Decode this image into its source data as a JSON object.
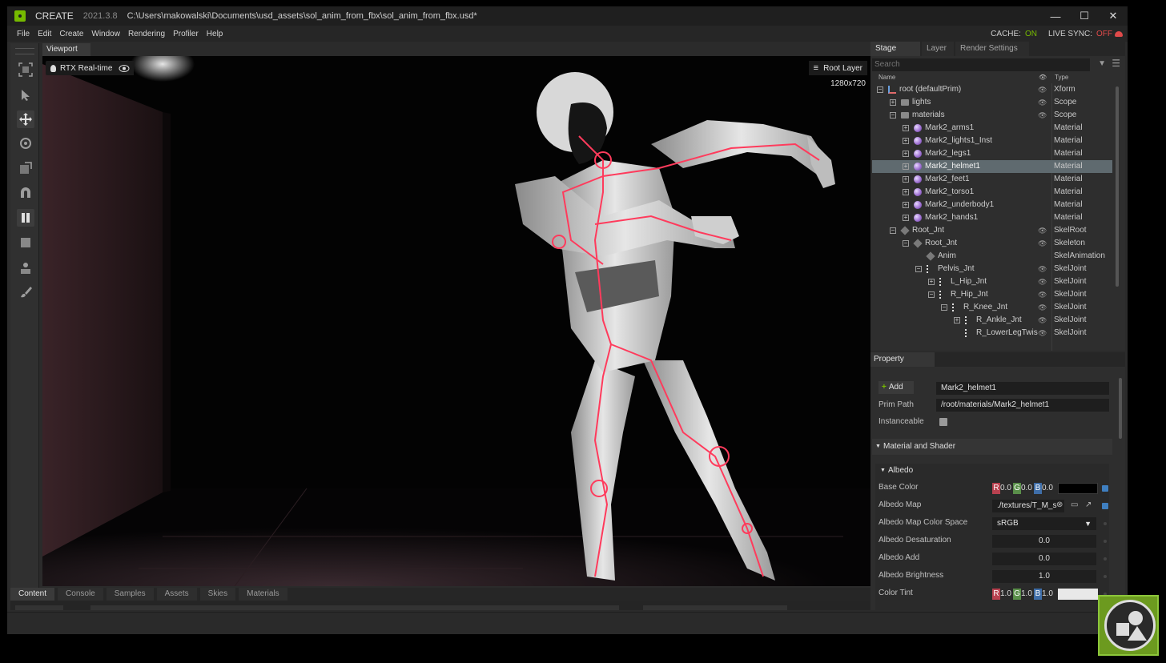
{
  "window": {
    "app_name": "CREATE",
    "version": "2021.3.8",
    "path": "C:\\Users\\makowalski\\Documents\\usd_assets\\sol_anim_from_fbx\\sol_anim_from_fbx.usd*",
    "controls": {
      "minimize": "—",
      "maximize": "☐",
      "close": "✕"
    }
  },
  "menu": {
    "items": [
      "File",
      "Edit",
      "Create",
      "Window",
      "Rendering",
      "Profiler",
      "Help"
    ],
    "cache_label": "CACHE:",
    "cache_value": "ON",
    "live_sync_label": "LIVE SYNC:",
    "live_sync_value": "OFF"
  },
  "viewport": {
    "tab_label": "Viewport",
    "render_mode": "RTX Real-time",
    "layer": "Root Layer",
    "resolution": "1280x720"
  },
  "toolbar": {
    "tools": [
      "frame-icon",
      "select-icon",
      "move-icon",
      "rotate-icon",
      "scale-icon",
      "snap-icon",
      "pause-icon",
      "stop-icon",
      "physics-icon",
      "paint-icon"
    ]
  },
  "bottom": {
    "tabs": [
      "Content",
      "Console",
      "Samples",
      "Assets",
      "Skies",
      "Materials"
    ],
    "active_tab": "Content"
  },
  "stage": {
    "tabs": [
      "Stage",
      "Layer",
      "Render Settings"
    ],
    "search_placeholder": "Search",
    "columns": {
      "name": "Name",
      "type": "Type"
    },
    "rows": [
      {
        "name": "root (defaultPrim)",
        "type": "Xform",
        "depth": 0,
        "expander": "minus",
        "icon": "xform",
        "eye": true
      },
      {
        "name": "lights",
        "type": "Scope",
        "depth": 1,
        "expander": "plus",
        "icon": "folder",
        "eye": true
      },
      {
        "name": "materials",
        "type": "Scope",
        "depth": 1,
        "expander": "minus",
        "icon": "folder",
        "eye": true
      },
      {
        "name": "Mark2_arms1",
        "type": "Material",
        "depth": 2,
        "expander": "plus",
        "icon": "material",
        "eye": false
      },
      {
        "name": "Mark2_lights1_Inst",
        "type": "Material",
        "depth": 2,
        "expander": "plus",
        "icon": "material",
        "eye": false
      },
      {
        "name": "Mark2_legs1",
        "type": "Material",
        "depth": 2,
        "expander": "plus",
        "icon": "material",
        "eye": false
      },
      {
        "name": "Mark2_helmet1",
        "type": "Material",
        "depth": 2,
        "expander": "plus",
        "icon": "material",
        "eye": false,
        "selected": true
      },
      {
        "name": "Mark2_feet1",
        "type": "Material",
        "depth": 2,
        "expander": "plus",
        "icon": "material",
        "eye": false
      },
      {
        "name": "Mark2_torso1",
        "type": "Material",
        "depth": 2,
        "expander": "plus",
        "icon": "material",
        "eye": false
      },
      {
        "name": "Mark2_underbody1",
        "type": "Material",
        "depth": 2,
        "expander": "plus",
        "icon": "material",
        "eye": false
      },
      {
        "name": "Mark2_hands1",
        "type": "Material",
        "depth": 2,
        "expander": "plus",
        "icon": "material",
        "eye": false
      },
      {
        "name": "Root_Jnt",
        "type": "SkelRoot",
        "depth": 1,
        "expander": "minus",
        "icon": "cube",
        "eye": true
      },
      {
        "name": "Root_Jnt",
        "type": "Skeleton",
        "depth": 2,
        "expander": "minus",
        "icon": "cube",
        "eye": true
      },
      {
        "name": "Anim",
        "type": "SkelAnimation",
        "depth": 3,
        "expander": "none",
        "icon": "cube",
        "eye": false
      },
      {
        "name": "Pelvis_Jnt",
        "type": "SkelJoint",
        "depth": 3,
        "expander": "minus",
        "icon": "joint",
        "eye": true
      },
      {
        "name": "L_Hip_Jnt",
        "type": "SkelJoint",
        "depth": 4,
        "expander": "plus",
        "icon": "joint",
        "eye": true
      },
      {
        "name": "R_Hip_Jnt",
        "type": "SkelJoint",
        "depth": 4,
        "expander": "minus",
        "icon": "joint",
        "eye": true
      },
      {
        "name": "R_Knee_Jnt",
        "type": "SkelJoint",
        "depth": 5,
        "expander": "minus",
        "icon": "joint",
        "eye": true
      },
      {
        "name": "R_Ankle_Jnt",
        "type": "SkelJoint",
        "depth": 6,
        "expander": "plus",
        "icon": "joint",
        "eye": true
      },
      {
        "name": "R_LowerLegTwis",
        "type": "SkelJoint",
        "depth": 6,
        "expander": "none",
        "icon": "joint",
        "eye": true
      }
    ]
  },
  "property": {
    "tab_label": "Property",
    "add_label": "Add",
    "prim_name": "Mark2_helmet1",
    "prim_path_label": "Prim Path",
    "prim_path": "/root/materials/Mark2_helmet1",
    "instanceable_label": "Instanceable",
    "section_label": "Material and Shader",
    "albedo_label": "Albedo",
    "base_color_label": "Base Color",
    "base_color": {
      "r": "0.0",
      "g": "0.0",
      "b": "0.0",
      "swatch": "#000000"
    },
    "albedo_map_label": "Albedo Map",
    "albedo_map_value": "./textures/T_M_s",
    "albedo_map_color_space_label": "Albedo Map Color Space",
    "albedo_map_color_space": "sRGB",
    "albedo_desaturation_label": "Albedo Desaturation",
    "albedo_desaturation": "0.0",
    "albedo_add_label": "Albedo Add",
    "albedo_add": "0.0",
    "albedo_brightness_label": "Albedo Brightness",
    "albedo_brightness": "1.0",
    "color_tint_label": "Color Tint",
    "color_tint": {
      "r": "1.0",
      "g": "1.0",
      "b": "1.0",
      "swatch": "#e8e8e8"
    }
  },
  "colors": {
    "accent_green": "#76b900",
    "sync_red": "#e04a4a",
    "skeleton": "#ff3b5c",
    "selected_row": "#5f6a6f"
  }
}
